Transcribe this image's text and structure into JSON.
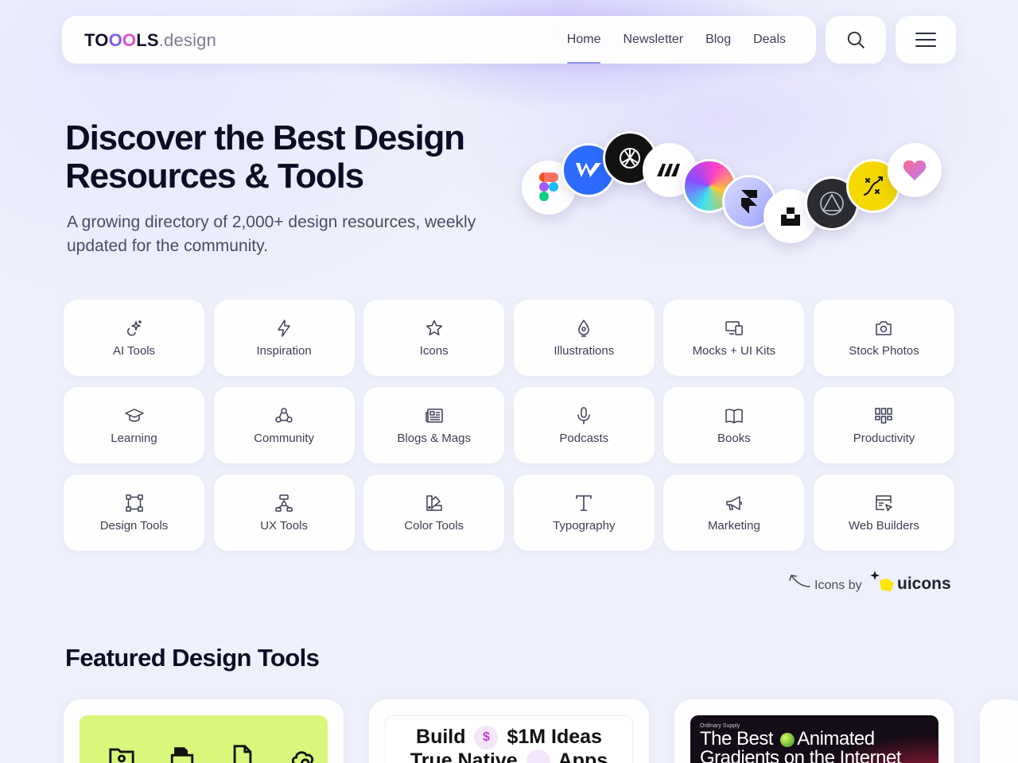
{
  "nav": {
    "logo_prefix": "TO",
    "logo_o3": "O",
    "logo_suffix": "LS",
    "logo_domain": ".design",
    "links": [
      "Home",
      "Newsletter",
      "Blog",
      "Deals"
    ],
    "active": "Home"
  },
  "hero": {
    "title": "Discover the Best Design Resources & Tools",
    "subtitle": "A growing directory of 2,000+ design resources, weekly updated for the community."
  },
  "categories": [
    {
      "label": "AI Tools",
      "icon": "ai-sparkle-icon"
    },
    {
      "label": "Inspiration",
      "icon": "lightning-icon"
    },
    {
      "label": "Icons",
      "icon": "star-icon"
    },
    {
      "label": "Illustrations",
      "icon": "pen-nib-icon"
    },
    {
      "label": "Mocks + UI Kits",
      "icon": "devices-icon"
    },
    {
      "label": "Stock Photos",
      "icon": "camera-icon"
    },
    {
      "label": "Learning",
      "icon": "graduation-cap-icon"
    },
    {
      "label": "Community",
      "icon": "community-icon"
    },
    {
      "label": "Blogs & Mags",
      "icon": "newspaper-icon"
    },
    {
      "label": "Podcasts",
      "icon": "microphone-icon"
    },
    {
      "label": "Books",
      "icon": "book-icon"
    },
    {
      "label": "Productivity",
      "icon": "grid-icon"
    },
    {
      "label": "Design Tools",
      "icon": "vector-square-icon"
    },
    {
      "label": "UX Tools",
      "icon": "flowchart-icon"
    },
    {
      "label": "Color Tools",
      "icon": "palette-swatch-icon"
    },
    {
      "label": "Typography",
      "icon": "text-t-icon"
    },
    {
      "label": "Marketing",
      "icon": "megaphone-icon"
    },
    {
      "label": "Web Builders",
      "icon": "browser-cursor-icon"
    }
  ],
  "credit": {
    "text": "Icons by",
    "brand": "uicons"
  },
  "featured": {
    "section_title": "Featured Design Tools",
    "card2_line1_a": "Build",
    "card2_coin": "$",
    "card2_line1_b": "$1M Ideas",
    "card2_line2_a": "True Native",
    "card2_line2_b": "Apps",
    "card3_small": "Ordinary Supply",
    "card3_title_a": "The Best",
    "card3_title_b": "Animated",
    "card3_title_c": "Gradients on the Internet"
  },
  "brand_logos": [
    "figma-logo-icon",
    "webflow-logo-icon",
    "openai-logo-icon",
    "miro-logo-icon",
    "gradient-orb-icon",
    "framer-logo-icon",
    "unsplash-logo-icon",
    "triangle-logo-icon",
    "path-tool-logo-icon",
    "heart-logo-icon"
  ]
}
